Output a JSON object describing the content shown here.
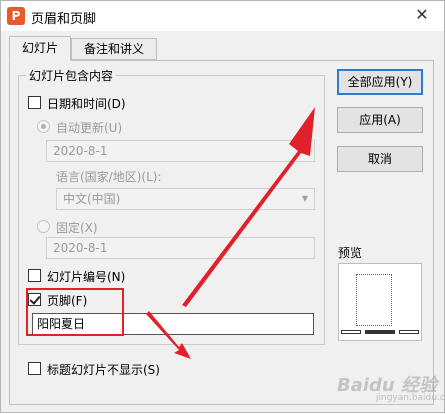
{
  "window": {
    "title": "页眉和页脚",
    "app_icon": "P",
    "close_glyph": "✕"
  },
  "tabs": [
    {
      "label": "幻灯片",
      "active": true
    },
    {
      "label": "备注和讲义",
      "active": false
    }
  ],
  "group": {
    "legend": "幻灯片包含内容",
    "date_time": {
      "label": "日期和时间(D)",
      "checked": false
    },
    "auto_update": {
      "label": "自动更新(U)",
      "selected": true,
      "value": "2020-8-1"
    },
    "language": {
      "label": "语言(国家/地区)(L):",
      "value": "中文(中国)"
    },
    "fixed": {
      "label": "固定(X)",
      "selected": false,
      "value": "2020-8-1"
    },
    "slide_number": {
      "label": "幻灯片编号(N)",
      "checked": false
    },
    "footer": {
      "label": "页脚(F)",
      "checked": true,
      "value": "阳阳夏日"
    }
  },
  "hide_on_title": {
    "label": "标题幻灯片不显示(S)",
    "checked": false
  },
  "buttons": {
    "apply_all": "全部应用(Y)",
    "apply": "应用(A)",
    "cancel": "取消"
  },
  "preview": {
    "label": "预览"
  },
  "watermark": {
    "text": "Baidu 经验",
    "sub": "jingyan.baidu.com"
  },
  "colors": {
    "annotation_red": "#e0202a",
    "default_button_border": "#2f7bd0"
  },
  "icons": [
    "app-logo-icon",
    "close-icon",
    "checkmark-icon",
    "dropdown-arrow-icon"
  ]
}
